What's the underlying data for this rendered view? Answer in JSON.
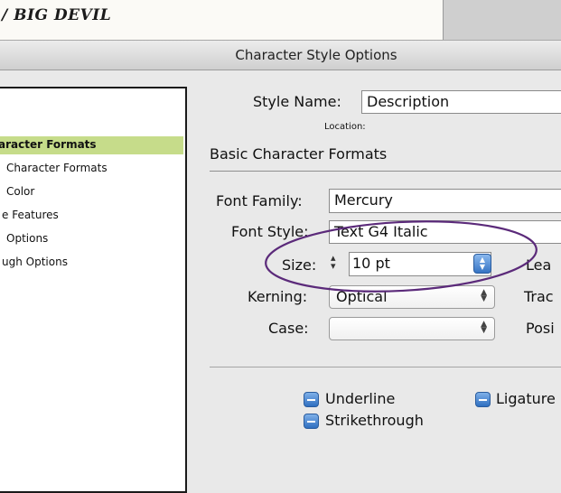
{
  "document": {
    "title": "/ BIG DEVIL"
  },
  "dialog": {
    "title": "Character Style Options",
    "style_name_label": "Style Name:",
    "style_name_value": "Description",
    "location_label": "Location:",
    "section_title": "Basic Character Formats"
  },
  "sidebar": {
    "items": [
      {
        "label": "aracter Formats",
        "selected": true
      },
      {
        "label": "Character Formats",
        "selected": false
      },
      {
        "label": "Color",
        "selected": false
      },
      {
        "label": "e Features",
        "selected": false
      },
      {
        "label": "Options",
        "selected": false
      },
      {
        "label": "ugh Options",
        "selected": false
      }
    ]
  },
  "form": {
    "font_family_label": "Font Family:",
    "font_family_value": "Mercury",
    "font_style_label": "Font Style:",
    "font_style_value": "Text G4 Italic",
    "size_label": "Size:",
    "size_value": "10 pt",
    "kerning_label": "Kerning:",
    "kerning_value": "Optical",
    "case_label": "Case:",
    "case_value": "",
    "leading_label": "Lea",
    "tracking_label": "Trac",
    "position_label": "Posi"
  },
  "checkboxes": {
    "underline": "Underline",
    "ligatures": "Ligature",
    "strikethrough": "Strikethrough"
  },
  "annotation": {
    "color": "#5b2a7a"
  },
  "colors": {
    "selected_row": "#c6dc8a",
    "checkbox": "#3a7ac9"
  }
}
